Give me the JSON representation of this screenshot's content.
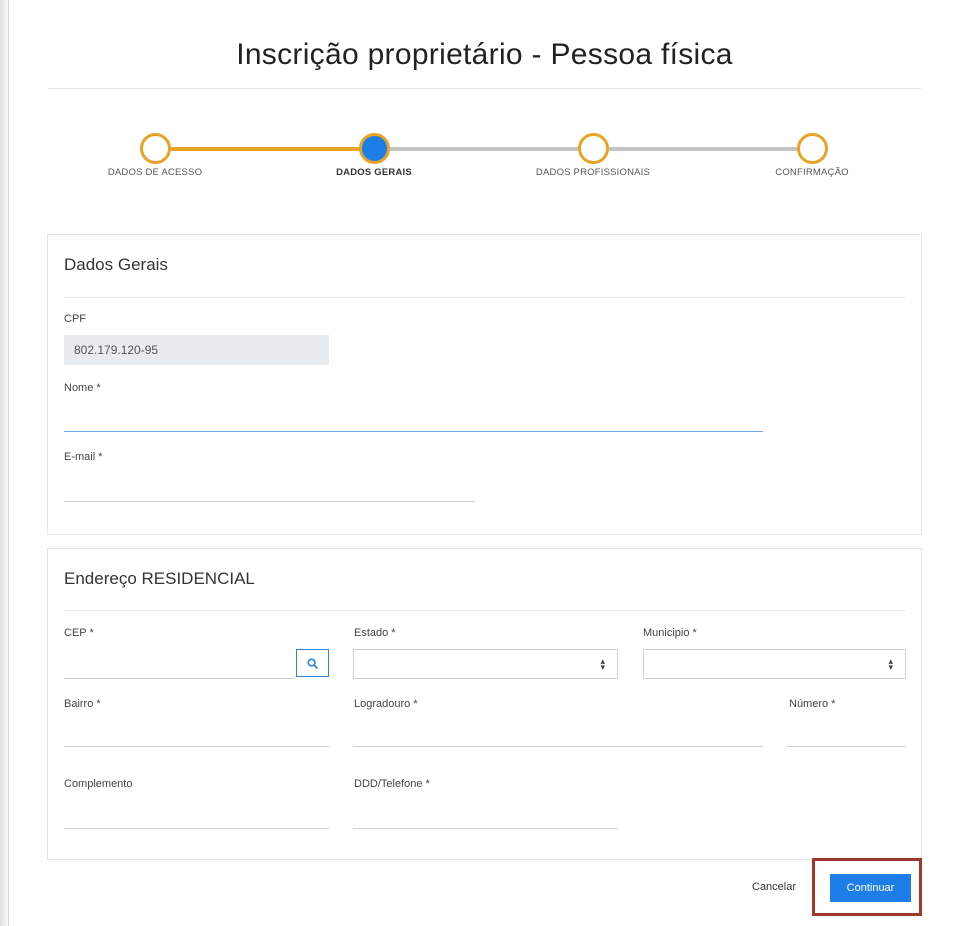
{
  "page": {
    "title": "Inscrição proprietário - Pessoa física"
  },
  "stepper": {
    "steps": [
      {
        "label": "DADOS DE ACESSO",
        "state": "completed"
      },
      {
        "label": "DADOS GERAIS",
        "state": "active"
      },
      {
        "label": "DADOS PROFISSIONAIS",
        "state": "pending"
      },
      {
        "label": "CONFIRMAÇÃO",
        "state": "pending"
      }
    ],
    "colors": {
      "completed": "#e8a326",
      "pending": "#c4c4c4",
      "active_fill": "#1e7ee8"
    }
  },
  "dados_gerais": {
    "title": "Dados Gerais",
    "cpf_label": "CPF",
    "cpf_value": "802.179.120-95",
    "nome_label": "Nome *",
    "nome_value": "",
    "email_label": "E-mail *",
    "email_value": ""
  },
  "endereco": {
    "title": "Endereço RESIDENCIAL",
    "cep_label": "CEP *",
    "cep_value": "",
    "estado_label": "Estado *",
    "estado_value": "",
    "municipio_label": "Municipio *",
    "municipio_value": "",
    "bairro_label": "Bairro *",
    "logradouro_label": "Logradouro *",
    "numero_label": "Número *",
    "complemento_label": "Complemento",
    "telefone_label": "DDD/Telefone *"
  },
  "actions": {
    "cancel_label": "Cancelar",
    "continue_label": "Continuar"
  }
}
